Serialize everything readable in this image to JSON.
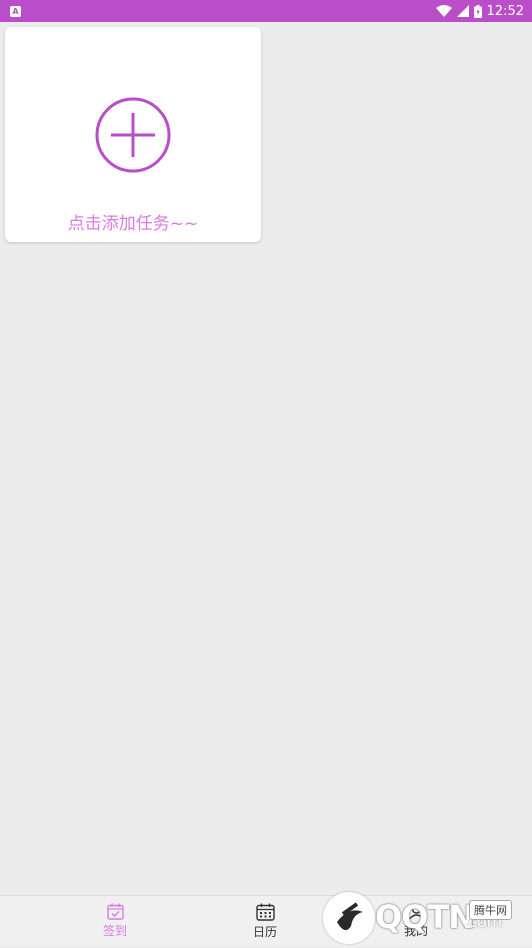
{
  "status_bar": {
    "notification_icon_letter": "A",
    "time": "12:52",
    "icons": [
      "wifi-icon",
      "signal-icon",
      "battery-icon"
    ]
  },
  "task_card": {
    "label": "点击添加任务~~",
    "icon": "add-circle-icon"
  },
  "bottom_nav": {
    "items": [
      {
        "label": "签到",
        "icon": "calendar-check-icon",
        "active": true
      },
      {
        "label": "日历",
        "icon": "calendar-icon",
        "active": false
      },
      {
        "label": "我的",
        "icon": "user-icon",
        "active": false
      }
    ]
  },
  "watermark": {
    "text": "QQTN",
    "suffix": ".com",
    "badge": "腾牛网"
  },
  "colors": {
    "accent": "#b94ec8",
    "accent_light": "#d97be3",
    "background": "#ececec"
  }
}
